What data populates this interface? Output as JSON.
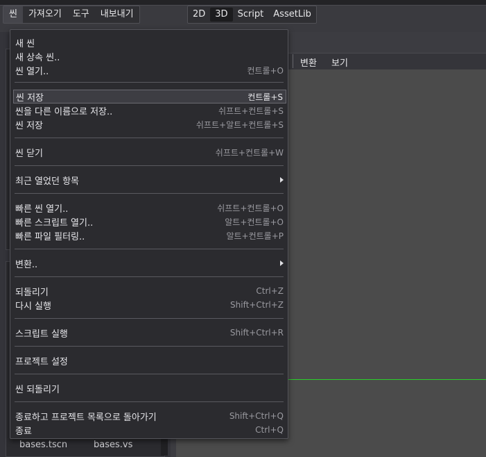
{
  "menubar": {
    "items": [
      "씬",
      "가져오기",
      "도구",
      "내보내기"
    ]
  },
  "workspace_tabs": [
    "2D",
    "3D",
    "Script",
    "AssetLib"
  ],
  "viewport_toolbar": {
    "transform": "변환",
    "view": "보기"
  },
  "filesystem": {
    "files": [
      "bases.tscn",
      "bases.vs"
    ]
  },
  "scene_menu": {
    "items": [
      {
        "label": "새 씬",
        "shortcut": ""
      },
      {
        "label": "새 상속 씬..",
        "shortcut": ""
      },
      {
        "label": "씬 열기..",
        "shortcut": "컨트롤+O"
      },
      {
        "label": "씬 저장",
        "shortcut": "컨트롤+S"
      },
      {
        "label": "씬을 다른 이름으로 저장..",
        "shortcut": "쉬프트+컨트롤+S"
      },
      {
        "label": "씬 저장",
        "shortcut": "쉬프트+알트+컨트롤+S"
      },
      {
        "label": "씬 닫기",
        "shortcut": "쉬프트+컨트롤+W"
      },
      {
        "label": "최근 열었던 항목",
        "shortcut": ""
      },
      {
        "label": "빠른 씬 열기..",
        "shortcut": "쉬프트+컨트롤+O"
      },
      {
        "label": "빠른 스크립트 열기..",
        "shortcut": "알트+컨트롤+O"
      },
      {
        "label": "빠른 파일 필터링..",
        "shortcut": "알트+컨트롤+P"
      },
      {
        "label": "변환..",
        "shortcut": ""
      },
      {
        "label": "되돌리기",
        "shortcut": "Ctrl+Z"
      },
      {
        "label": "다시 실행",
        "shortcut": "Shift+Ctrl+Z"
      },
      {
        "label": "스크립트 실행",
        "shortcut": "Shift+Ctrl+R"
      },
      {
        "label": "프로젝트 설정",
        "shortcut": ""
      },
      {
        "label": "씬 되돌리기",
        "shortcut": ""
      },
      {
        "label": "종료하고 프로젝트 목록으로 돌아가기",
        "shortcut": "Shift+Ctrl+Q"
      },
      {
        "label": "종료",
        "shortcut": "Ctrl+Q"
      }
    ]
  },
  "icons": {
    "submenu": "submenu-arrow-icon"
  },
  "colors": {
    "viewport_line": "#2bd02b",
    "menu_bg": "#2b2b2f"
  }
}
